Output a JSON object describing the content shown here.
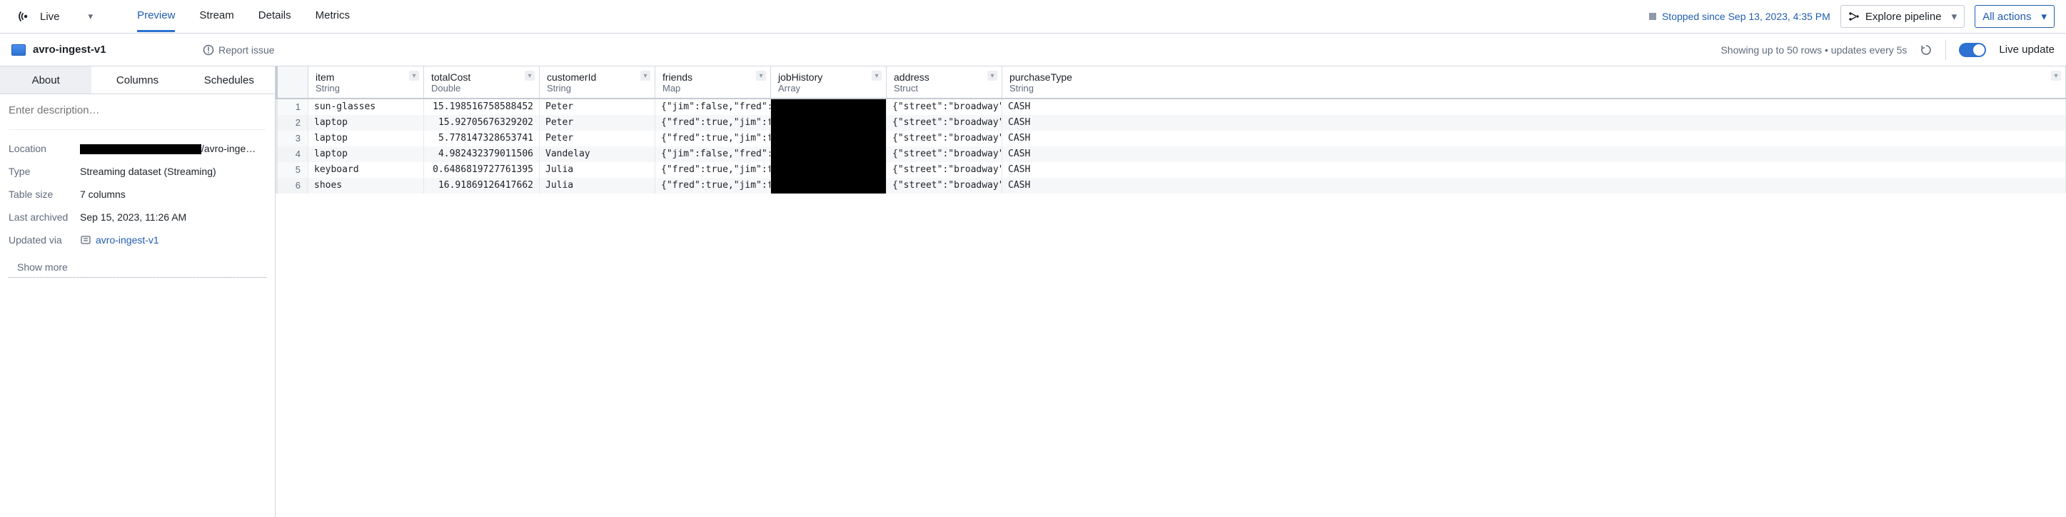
{
  "topbar": {
    "live_label": "Live",
    "tabs": [
      "Preview",
      "Stream",
      "Details",
      "Metrics"
    ],
    "active_tab": 0,
    "status": "Stopped since Sep 13, 2023, 4:35 PM",
    "explore_label": "Explore pipeline",
    "actions_label": "All actions"
  },
  "header": {
    "dataset_name": "avro-ingest-v1",
    "report_label": "Report issue",
    "rows_label": "Showing up to 50 rows • updates every 5s",
    "live_update_label": "Live update"
  },
  "sidebar": {
    "tabs": [
      "About",
      "Columns",
      "Schedules"
    ],
    "active_tab": 0,
    "description_placeholder": "Enter description…",
    "meta": {
      "location_k": "Location",
      "location_v": "/avro-inge…",
      "type_k": "Type",
      "type_v": "Streaming dataset (Streaming)",
      "size_k": "Table size",
      "size_v": "7 columns",
      "archived_k": "Last archived",
      "archived_v": "Sep 15, 2023, 11:26 AM",
      "updated_k": "Updated via",
      "updated_v": "avro-ingest-v1"
    },
    "show_more": "Show more"
  },
  "grid": {
    "columns": [
      {
        "name": "item",
        "type": "String"
      },
      {
        "name": "totalCost",
        "type": "Double"
      },
      {
        "name": "customerId",
        "type": "String"
      },
      {
        "name": "friends",
        "type": "Map"
      },
      {
        "name": "jobHistory",
        "type": "Array"
      },
      {
        "name": "address",
        "type": "Struct"
      },
      {
        "name": "purchaseType",
        "type": "String"
      }
    ],
    "rows": [
      {
        "n": 1,
        "item": "sun-glasses",
        "totalCost": "15.198516758588452",
        "customerId": "Peter",
        "friends": "{\"jim\":false,\"fred\":",
        "jobHistory": "",
        "address": "{\"street\":\"broadway\"",
        "purchaseType": "CASH"
      },
      {
        "n": 2,
        "item": "laptop",
        "totalCost": "15.92705676329202",
        "customerId": "Peter",
        "friends": "{\"fred\":true,\"jim\":f",
        "jobHistory": "",
        "address": "{\"street\":\"broadway\"",
        "purchaseType": "CASH"
      },
      {
        "n": 3,
        "item": "laptop",
        "totalCost": "5.778147328653741",
        "customerId": "Peter",
        "friends": "{\"fred\":true,\"jim\":f",
        "jobHistory": "",
        "address": "{\"street\":\"broadway\"",
        "purchaseType": "CASH"
      },
      {
        "n": 4,
        "item": "laptop",
        "totalCost": "4.982432379011506",
        "customerId": "Vandelay",
        "friends": "{\"jim\":false,\"fred\":",
        "jobHistory": "",
        "address": "{\"street\":\"broadway\"",
        "purchaseType": "CASH"
      },
      {
        "n": 5,
        "item": "keyboard",
        "totalCost": "0.6486819727761395",
        "customerId": "Julia",
        "friends": "{\"fred\":true,\"jim\":f",
        "jobHistory": "",
        "address": "{\"street\":\"broadway\"",
        "purchaseType": "CASH"
      },
      {
        "n": 6,
        "item": "shoes",
        "totalCost": "16.91869126417662",
        "customerId": "Julia",
        "friends": "{\"fred\":true,\"jim\":f",
        "jobHistory": "",
        "address": "{\"street\":\"broadway\"",
        "purchaseType": "CASH"
      }
    ]
  }
}
